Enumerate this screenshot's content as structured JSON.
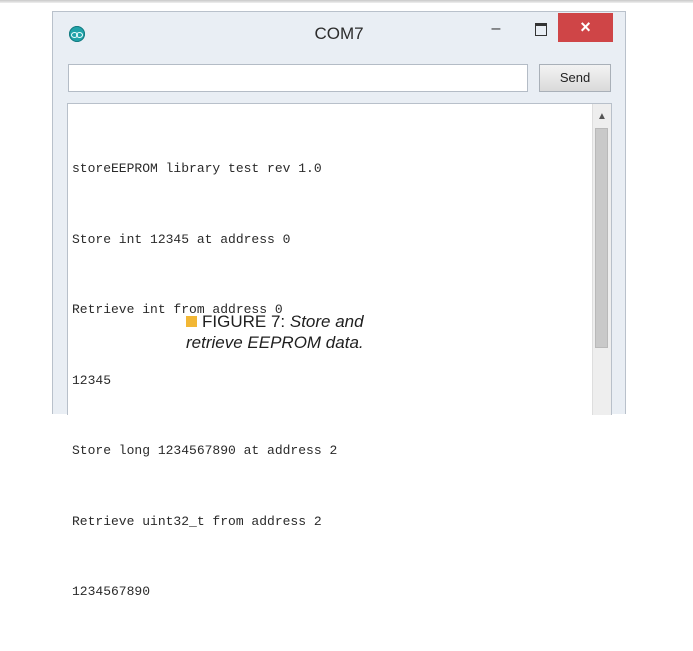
{
  "window": {
    "title": "COM7",
    "minimize_glyph": "–",
    "close_glyph": "×"
  },
  "input": {
    "value": "",
    "send_label": "Send"
  },
  "output": {
    "lines": [
      "storeEEPROM library test rev 1.0",
      "Store int 12345 at address 0",
      "Retrieve int from address 0",
      "12345",
      "Store long 1234567890 at address 2",
      "Retrieve uint32_t from address 2",
      "1234567890"
    ]
  },
  "caption": {
    "label": "FIGURE 7:",
    "line1": "Store and",
    "line2": "retrieve EEPROM data."
  },
  "icons": {
    "app": "arduino-icon",
    "scroll": "scroll-up-arrow-icon"
  },
  "colors": {
    "close_button": "#cf4547",
    "app_icon": "#21a3a9",
    "caption_square": "#f2b735"
  }
}
